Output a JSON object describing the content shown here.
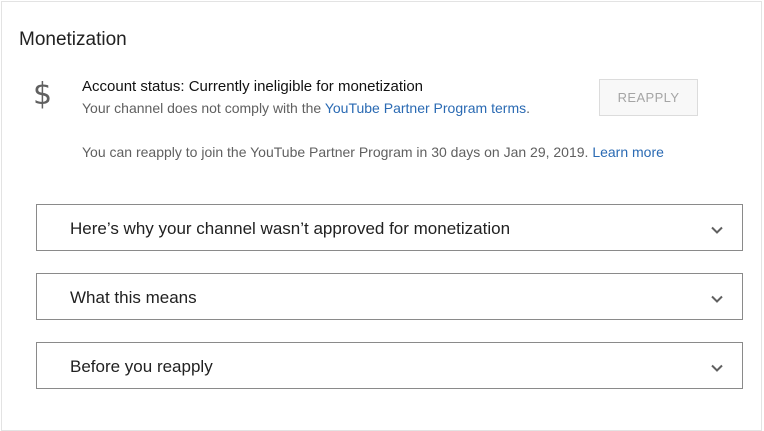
{
  "section": {
    "title": "Monetization"
  },
  "account": {
    "icon": "dollar-icon",
    "status_text": "Account status: Currently ineligible for monetization",
    "sub_prefix": "Your channel does not comply with the ",
    "sub_link": "YouTube Partner Program terms",
    "sub_suffix": ".",
    "reapply_button": "REAPPLY",
    "note_text": "You can reapply to join the YouTube Partner Program in 30 days on Jan 29, 2019. ",
    "note_link": "Learn more"
  },
  "panels": [
    {
      "label": "Here’s why your channel wasn’t approved for monetization",
      "icon": "chevron-down-icon"
    },
    {
      "label": "What this means",
      "icon": "chevron-down-icon"
    },
    {
      "label": "Before you reapply",
      "icon": "chevron-down-icon"
    }
  ],
  "colors": {
    "link": "#2a6ab3",
    "panel_border": "#8a8a8a",
    "disabled_button_text": "#a5a5a5"
  }
}
